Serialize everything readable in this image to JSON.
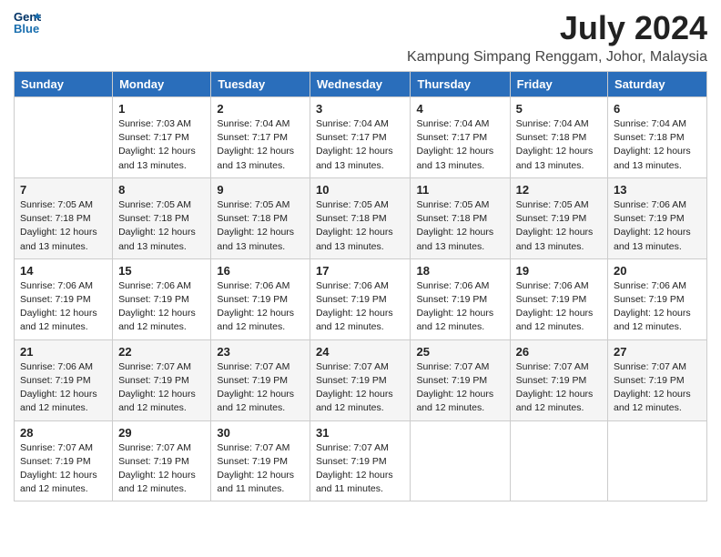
{
  "logo": {
    "line1": "General",
    "line2": "Blue"
  },
  "title": "July 2024",
  "subtitle": "Kampung Simpang Renggam, Johor, Malaysia",
  "days_of_week": [
    "Sunday",
    "Monday",
    "Tuesday",
    "Wednesday",
    "Thursday",
    "Friday",
    "Saturday"
  ],
  "weeks": [
    [
      {
        "day": "",
        "sunrise": "",
        "sunset": "",
        "daylight": ""
      },
      {
        "day": "1",
        "sunrise": "Sunrise: 7:03 AM",
        "sunset": "Sunset: 7:17 PM",
        "daylight": "Daylight: 12 hours and 13 minutes."
      },
      {
        "day": "2",
        "sunrise": "Sunrise: 7:04 AM",
        "sunset": "Sunset: 7:17 PM",
        "daylight": "Daylight: 12 hours and 13 minutes."
      },
      {
        "day": "3",
        "sunrise": "Sunrise: 7:04 AM",
        "sunset": "Sunset: 7:17 PM",
        "daylight": "Daylight: 12 hours and 13 minutes."
      },
      {
        "day": "4",
        "sunrise": "Sunrise: 7:04 AM",
        "sunset": "Sunset: 7:17 PM",
        "daylight": "Daylight: 12 hours and 13 minutes."
      },
      {
        "day": "5",
        "sunrise": "Sunrise: 7:04 AM",
        "sunset": "Sunset: 7:18 PM",
        "daylight": "Daylight: 12 hours and 13 minutes."
      },
      {
        "day": "6",
        "sunrise": "Sunrise: 7:04 AM",
        "sunset": "Sunset: 7:18 PM",
        "daylight": "Daylight: 12 hours and 13 minutes."
      }
    ],
    [
      {
        "day": "7",
        "sunrise": "Sunrise: 7:05 AM",
        "sunset": "Sunset: 7:18 PM",
        "daylight": "Daylight: 12 hours and 13 minutes."
      },
      {
        "day": "8",
        "sunrise": "Sunrise: 7:05 AM",
        "sunset": "Sunset: 7:18 PM",
        "daylight": "Daylight: 12 hours and 13 minutes."
      },
      {
        "day": "9",
        "sunrise": "Sunrise: 7:05 AM",
        "sunset": "Sunset: 7:18 PM",
        "daylight": "Daylight: 12 hours and 13 minutes."
      },
      {
        "day": "10",
        "sunrise": "Sunrise: 7:05 AM",
        "sunset": "Sunset: 7:18 PM",
        "daylight": "Daylight: 12 hours and 13 minutes."
      },
      {
        "day": "11",
        "sunrise": "Sunrise: 7:05 AM",
        "sunset": "Sunset: 7:18 PM",
        "daylight": "Daylight: 12 hours and 13 minutes."
      },
      {
        "day": "12",
        "sunrise": "Sunrise: 7:05 AM",
        "sunset": "Sunset: 7:19 PM",
        "daylight": "Daylight: 12 hours and 13 minutes."
      },
      {
        "day": "13",
        "sunrise": "Sunrise: 7:06 AM",
        "sunset": "Sunset: 7:19 PM",
        "daylight": "Daylight: 12 hours and 13 minutes."
      }
    ],
    [
      {
        "day": "14",
        "sunrise": "Sunrise: 7:06 AM",
        "sunset": "Sunset: 7:19 PM",
        "daylight": "Daylight: 12 hours and 12 minutes."
      },
      {
        "day": "15",
        "sunrise": "Sunrise: 7:06 AM",
        "sunset": "Sunset: 7:19 PM",
        "daylight": "Daylight: 12 hours and 12 minutes."
      },
      {
        "day": "16",
        "sunrise": "Sunrise: 7:06 AM",
        "sunset": "Sunset: 7:19 PM",
        "daylight": "Daylight: 12 hours and 12 minutes."
      },
      {
        "day": "17",
        "sunrise": "Sunrise: 7:06 AM",
        "sunset": "Sunset: 7:19 PM",
        "daylight": "Daylight: 12 hours and 12 minutes."
      },
      {
        "day": "18",
        "sunrise": "Sunrise: 7:06 AM",
        "sunset": "Sunset: 7:19 PM",
        "daylight": "Daylight: 12 hours and 12 minutes."
      },
      {
        "day": "19",
        "sunrise": "Sunrise: 7:06 AM",
        "sunset": "Sunset: 7:19 PM",
        "daylight": "Daylight: 12 hours and 12 minutes."
      },
      {
        "day": "20",
        "sunrise": "Sunrise: 7:06 AM",
        "sunset": "Sunset: 7:19 PM",
        "daylight": "Daylight: 12 hours and 12 minutes."
      }
    ],
    [
      {
        "day": "21",
        "sunrise": "Sunrise: 7:06 AM",
        "sunset": "Sunset: 7:19 PM",
        "daylight": "Daylight: 12 hours and 12 minutes."
      },
      {
        "day": "22",
        "sunrise": "Sunrise: 7:07 AM",
        "sunset": "Sunset: 7:19 PM",
        "daylight": "Daylight: 12 hours and 12 minutes."
      },
      {
        "day": "23",
        "sunrise": "Sunrise: 7:07 AM",
        "sunset": "Sunset: 7:19 PM",
        "daylight": "Daylight: 12 hours and 12 minutes."
      },
      {
        "day": "24",
        "sunrise": "Sunrise: 7:07 AM",
        "sunset": "Sunset: 7:19 PM",
        "daylight": "Daylight: 12 hours and 12 minutes."
      },
      {
        "day": "25",
        "sunrise": "Sunrise: 7:07 AM",
        "sunset": "Sunset: 7:19 PM",
        "daylight": "Daylight: 12 hours and 12 minutes."
      },
      {
        "day": "26",
        "sunrise": "Sunrise: 7:07 AM",
        "sunset": "Sunset: 7:19 PM",
        "daylight": "Daylight: 12 hours and 12 minutes."
      },
      {
        "day": "27",
        "sunrise": "Sunrise: 7:07 AM",
        "sunset": "Sunset: 7:19 PM",
        "daylight": "Daylight: 12 hours and 12 minutes."
      }
    ],
    [
      {
        "day": "28",
        "sunrise": "Sunrise: 7:07 AM",
        "sunset": "Sunset: 7:19 PM",
        "daylight": "Daylight: 12 hours and 12 minutes."
      },
      {
        "day": "29",
        "sunrise": "Sunrise: 7:07 AM",
        "sunset": "Sunset: 7:19 PM",
        "daylight": "Daylight: 12 hours and 12 minutes."
      },
      {
        "day": "30",
        "sunrise": "Sunrise: 7:07 AM",
        "sunset": "Sunset: 7:19 PM",
        "daylight": "Daylight: 12 hours and 11 minutes."
      },
      {
        "day": "31",
        "sunrise": "Sunrise: 7:07 AM",
        "sunset": "Sunset: 7:19 PM",
        "daylight": "Daylight: 12 hours and 11 minutes."
      },
      {
        "day": "",
        "sunrise": "",
        "sunset": "",
        "daylight": ""
      },
      {
        "day": "",
        "sunrise": "",
        "sunset": "",
        "daylight": ""
      },
      {
        "day": "",
        "sunrise": "",
        "sunset": "",
        "daylight": ""
      }
    ]
  ]
}
